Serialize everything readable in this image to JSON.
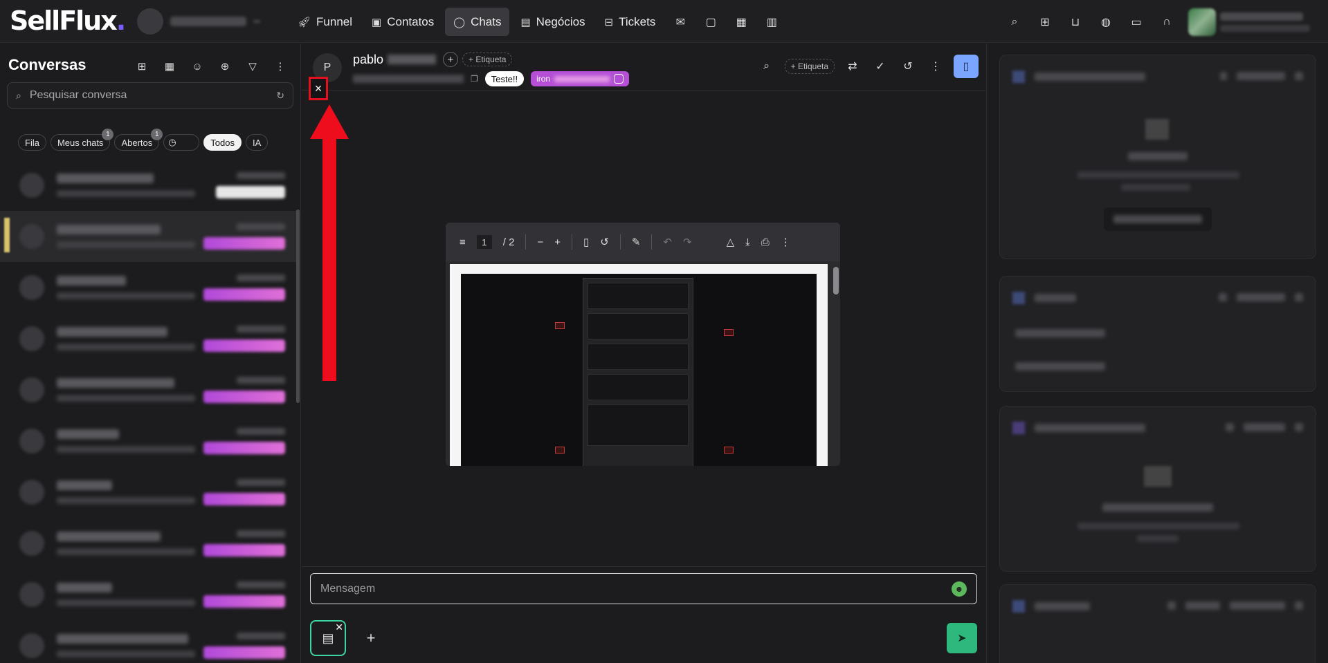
{
  "app": {
    "logo": "SellFlux",
    "logo_dot": "."
  },
  "nav": {
    "items": [
      {
        "label": "Funnel",
        "icon": "rocket-icon"
      },
      {
        "label": "Contatos",
        "icon": "contacts-icon"
      },
      {
        "label": "Chats",
        "icon": "chat-icon",
        "active": true
      },
      {
        "label": "Negócios",
        "icon": "briefcase-icon"
      },
      {
        "label": "Tickets",
        "icon": "ticket-icon"
      }
    ]
  },
  "sidebar": {
    "title": "Conversas",
    "search_placeholder": "Pesquisar conversa",
    "filters": [
      {
        "label": "Fila"
      },
      {
        "label": "Meus chats",
        "badge": "1"
      },
      {
        "label": "Abertos",
        "badge": "1"
      },
      {
        "label": ""
      },
      {
        "label": "Todos",
        "selected": true
      },
      {
        "label": "IA"
      }
    ]
  },
  "chat": {
    "contact_initial": "P",
    "contact_name": "pablo",
    "tag_add_label": "+ Etiqueta",
    "header_tag_label": "+ Etiqueta",
    "tag_teste": "Teste!!",
    "tag_iron": "iron",
    "close_label": "×",
    "pdf": {
      "page": "1",
      "total": "/ 2"
    },
    "composer_placeholder": "Mensagem"
  },
  "colors": {
    "accent_blue": "#7aa6ff",
    "send_green": "#2fb87e",
    "tag_purple": "#b44fd6",
    "annotation_red": "#ee0d1c"
  }
}
